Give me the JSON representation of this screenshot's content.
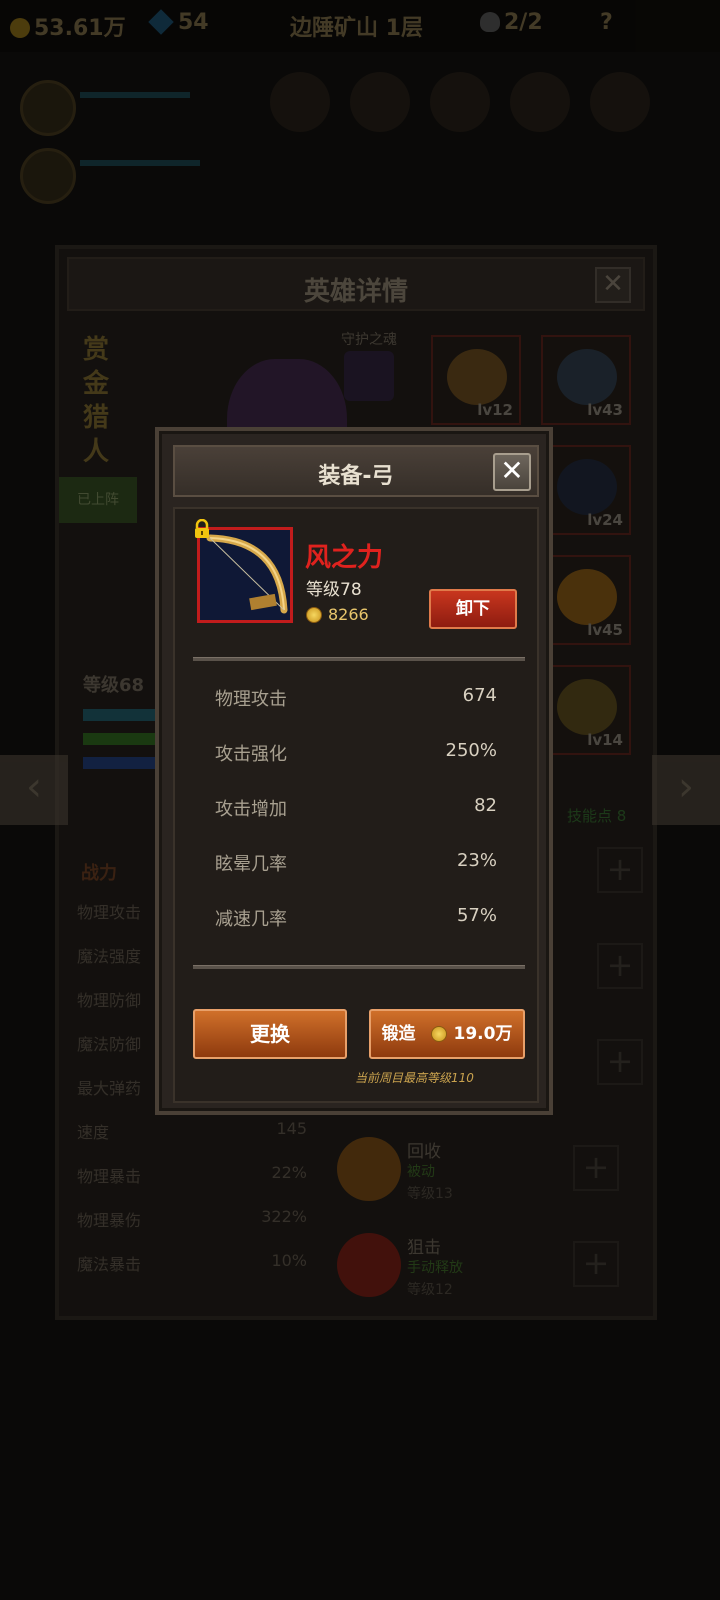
{
  "hud": {
    "gold": "53.61万",
    "gems": "54",
    "location": "边陲矿山 1层",
    "kills": "2/2",
    "help": "?"
  },
  "hero": {
    "title": "英雄详情",
    "name": "赏金猎人",
    "guard_label": "守护之魂",
    "deployed": "已上阵",
    "level": "等级68",
    "equipment": [
      {
        "level": "lv12"
      },
      {
        "level": "lv43"
      },
      {
        "level": "lv24"
      },
      {
        "level": "lv45"
      },
      {
        "level": "lv14"
      }
    ],
    "combat_label": "战力",
    "stats": [
      {
        "name": "物理攻击",
        "value": ""
      },
      {
        "name": "魔法强度",
        "value": ""
      },
      {
        "name": "物理防御",
        "value": ""
      },
      {
        "name": "魔法防御",
        "value": ""
      },
      {
        "name": "最大弹药",
        "value": ""
      },
      {
        "name": "速度",
        "value": "145"
      },
      {
        "name": "物理暴击",
        "value": "22%"
      },
      {
        "name": "物理暴伤",
        "value": "322%"
      },
      {
        "name": "魔法暴击",
        "value": "10%"
      }
    ],
    "skill_points": "技能点 8",
    "skills": [
      {
        "name": "回收",
        "type": "被动",
        "level": "等级13"
      },
      {
        "name": "狙击",
        "type": "手动释放",
        "level": "等级12"
      }
    ]
  },
  "modal": {
    "title": "装备-弓",
    "close": "✕",
    "item": {
      "name": "风之力",
      "level": "等级78",
      "price": "8266",
      "unequip": "卸下"
    },
    "attributes": [
      {
        "name": "物理攻击",
        "value": "674"
      },
      {
        "name": "攻击强化",
        "value": "250%"
      },
      {
        "name": "攻击增加",
        "value": "82"
      },
      {
        "name": "眩晕几率",
        "value": "23%"
      },
      {
        "name": "减速几率",
        "value": "57%"
      }
    ],
    "replace": "更换",
    "forge": "锻造",
    "forge_cost": "19.0万",
    "max_note": "当前周目最高等级110"
  },
  "colors": {
    "item_name": "#e0221e",
    "item_frame": "#c21c1c",
    "button_orange": "#b85a1e",
    "unequip_red": "#b02a18",
    "price_gold": "#e9c66c"
  },
  "icons": [
    "gold-coin-icon",
    "gem-icon",
    "skull-icon",
    "help-icon",
    "close-icon",
    "bow-icon",
    "lock-icon",
    "plus-icon",
    "arrow-left-icon",
    "arrow-right-icon"
  ]
}
